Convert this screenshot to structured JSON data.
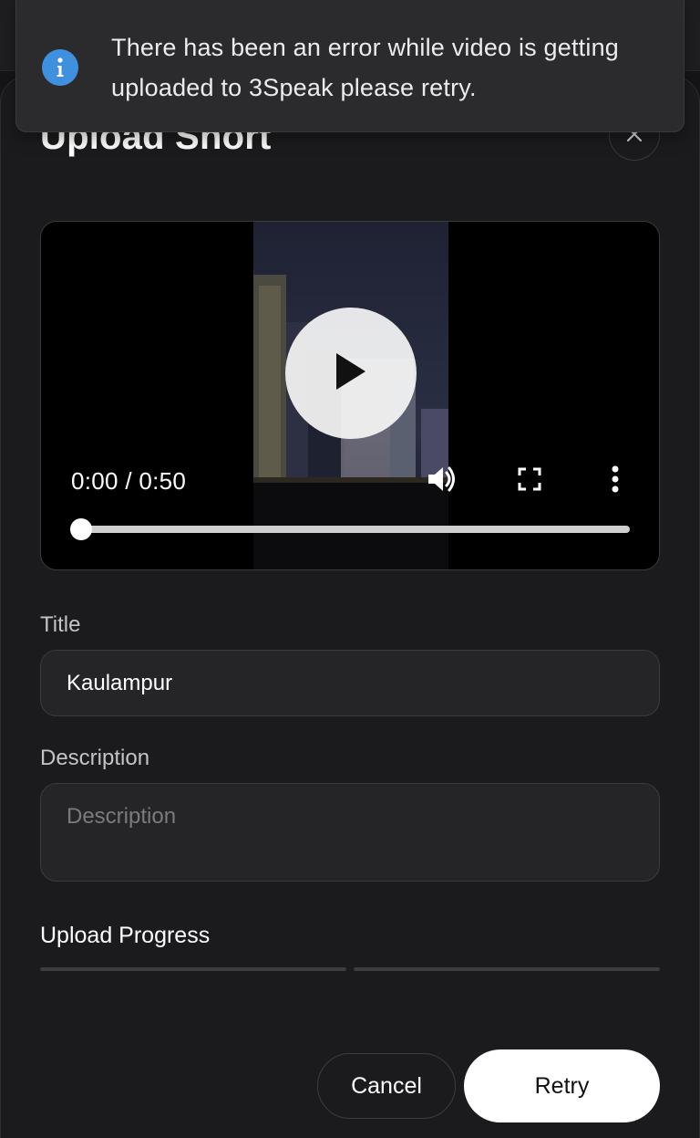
{
  "notification": {
    "icon": "info-icon",
    "message": "There has been an error while video is getting uploaded to 3Speak please retry."
  },
  "modal": {
    "title": "Upload Short",
    "close_icon": "close-icon"
  },
  "video_player": {
    "time_display": "0:00 / 0:50",
    "progress": 0,
    "icons": [
      "play-icon",
      "volume-icon",
      "fullscreen-icon",
      "more-vert-icon"
    ]
  },
  "form": {
    "title_label": "Title",
    "title_value": "Kaulampur",
    "description_label": "Description",
    "description_placeholder": "Description",
    "description_value": ""
  },
  "upload_progress": {
    "label": "Upload Progress",
    "segments_complete": 0,
    "segments_total": 2
  },
  "actions": {
    "cancel_label": "Cancel",
    "retry_label": "Retry"
  },
  "colors": {
    "background": "#1b1b1d",
    "info_accent": "#3f91e0",
    "primary_button": "#ffffff"
  }
}
